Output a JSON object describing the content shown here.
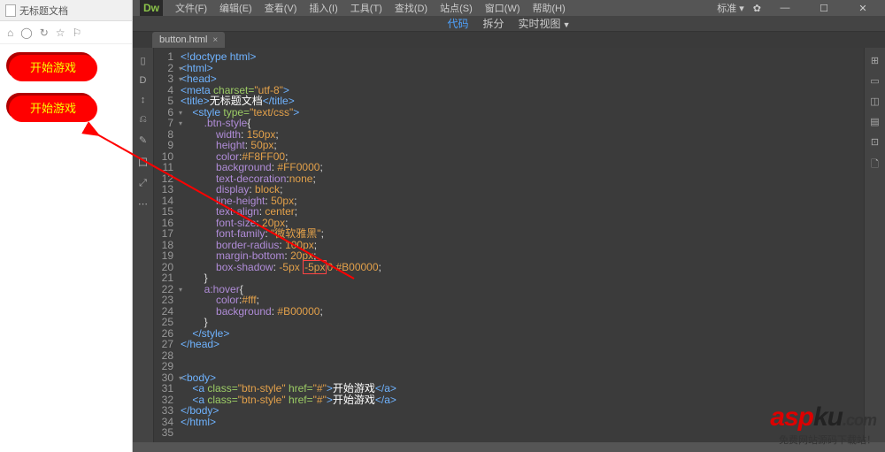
{
  "preview": {
    "title": "无标题文档",
    "nav_icons": [
      "⌂",
      "◯",
      "↻",
      "☆",
      "⚐"
    ],
    "btn1": "开始游戏",
    "btn2": "开始游戏"
  },
  "menubar": {
    "logo": "Dw",
    "items": [
      "文件(F)",
      "编辑(E)",
      "查看(V)",
      "插入(I)",
      "工具(T)",
      "查找(D)",
      "站点(S)",
      "窗口(W)",
      "帮助(H)"
    ],
    "standard": "标准 ▾",
    "gear": "✿",
    "min": "—",
    "max": "☐",
    "close": "✕"
  },
  "viewbar": {
    "code": "代码",
    "split": "拆分",
    "live": "实时视图"
  },
  "tab": {
    "name": "button.html",
    "close": "×"
  },
  "tools_left": [
    "▯",
    "D",
    "↕",
    "⎌",
    "✎",
    "囗",
    "⤢",
    "⋯"
  ],
  "tools_right": [
    "⊞",
    "▭",
    "◫",
    "▤",
    "⊡",
    "🗋"
  ],
  "code": [
    {
      "n": 1,
      "h": "<span class='tag'>&lt;!doctype html&gt;</span>"
    },
    {
      "n": 2,
      "f": "▾",
      "h": "<span class='tag'>&lt;html&gt;</span>"
    },
    {
      "n": 3,
      "f": "▾",
      "h": "<span class='tag'>&lt;head&gt;</span>"
    },
    {
      "n": 4,
      "h": "<span class='tag'>&lt;meta</span> <span class='attr'>charset=</span><span class='val'>\"utf-8\"</span><span class='tag'>&gt;</span>"
    },
    {
      "n": 5,
      "h": "<span class='tag'>&lt;title&gt;</span><span class='txt'>无标题文档</span><span class='tag'>&lt;/title&gt;</span>"
    },
    {
      "n": 6,
      "f": "▾",
      "h": "    <span class='tag'>&lt;style</span> <span class='attr'>type=</span><span class='val'>\"text/css\"</span><span class='tag'>&gt;</span>"
    },
    {
      "n": 7,
      "f": "▾",
      "h": "        <span class='kw'>.btn-style</span>{"
    },
    {
      "n": 8,
      "h": "            <span class='kw'>width</span>: <span class='num'>150px</span>;"
    },
    {
      "n": 9,
      "h": "            <span class='kw'>height</span>: <span class='num'>50px</span>;"
    },
    {
      "n": 10,
      "h": "            <span class='kw'>color</span>:<span class='num'>#F8FF00</span>;"
    },
    {
      "n": 11,
      "h": "            <span class='kw'>background</span>: <span class='num'>#FF0000</span>;"
    },
    {
      "n": 12,
      "h": "            <span class='kw'>text-decoration</span>:<span class='num'>none</span>;"
    },
    {
      "n": 13,
      "h": "            <span class='kw'>display</span>: <span class='num'>block</span>;"
    },
    {
      "n": 14,
      "h": "            <span class='kw'>line-height</span>: <span class='num'>50px</span>;"
    },
    {
      "n": 15,
      "h": "            <span class='kw'>text-align</span>: <span class='num'>center</span>;"
    },
    {
      "n": 16,
      "h": "            <span class='kw'>font-size</span>: <span class='num'>20px</span>;"
    },
    {
      "n": 17,
      "h": "            <span class='kw'>font-family</span>: <span class='val'>\"微软雅黑\"</span>;"
    },
    {
      "n": 18,
      "h": "            <span class='kw'>border-radius</span>: <span class='num'>100px</span>;"
    },
    {
      "n": 19,
      "h": "            <span class='kw'>margin-bottom</span>: <span class='num'>20px</span>;"
    },
    {
      "n": 20,
      "h": "            <span class='kw'>box-shadow</span>: <span class='num'>-5px</span> <span class='num box-hl'>-5px</span><span class='num'>0</span> <span class='num'>#B00000</span>;"
    },
    {
      "n": 21,
      "h": "        }"
    },
    {
      "n": 22,
      "f": "▾",
      "h": "        <span class='kw'>a:hover</span>{"
    },
    {
      "n": 23,
      "h": "            <span class='kw'>color</span>:<span class='num'>#fff</span>;"
    },
    {
      "n": 24,
      "h": "            <span class='kw'>background</span>: <span class='num'>#B00000</span>;"
    },
    {
      "n": 25,
      "h": "        }"
    },
    {
      "n": 26,
      "h": "    <span class='tag'>&lt;/style&gt;</span>"
    },
    {
      "n": 27,
      "h": "<span class='tag'>&lt;/head&gt;</span>"
    },
    {
      "n": 28,
      "h": ""
    },
    {
      "n": 29,
      "h": ""
    },
    {
      "n": 30,
      "f": "▾",
      "h": "<span class='tag'>&lt;body&gt;</span>"
    },
    {
      "n": 31,
      "h": "    <span class='tag'>&lt;a</span> <span class='attr'>class=</span><span class='val'>\"btn-style\"</span> <span class='attr'>href=</span><span class='val'>\"#\"</span><span class='tag'>&gt;</span><span class='txt'>开始游戏</span><span class='tag'>&lt;/a&gt;</span>"
    },
    {
      "n": 32,
      "h": "    <span class='tag'>&lt;a</span> <span class='attr'>class=</span><span class='val'>\"btn-style\"</span> <span class='attr'>href=</span><span class='val'>\"#\"</span><span class='tag'>&gt;</span><span class='txt'>开始游戏</span><span class='tag'>&lt;/a&gt;</span>"
    },
    {
      "n": 33,
      "h": "<span class='tag'>&lt;/body&gt;</span>"
    },
    {
      "n": 34,
      "h": "<span class='tag'>&lt;/html&gt;</span>"
    },
    {
      "n": 35,
      "h": ""
    }
  ],
  "watermark": {
    "brand_a": "asp",
    "brand_b": "ku",
    "dot": ".com",
    "sub": "免费网站源码下载站！"
  }
}
